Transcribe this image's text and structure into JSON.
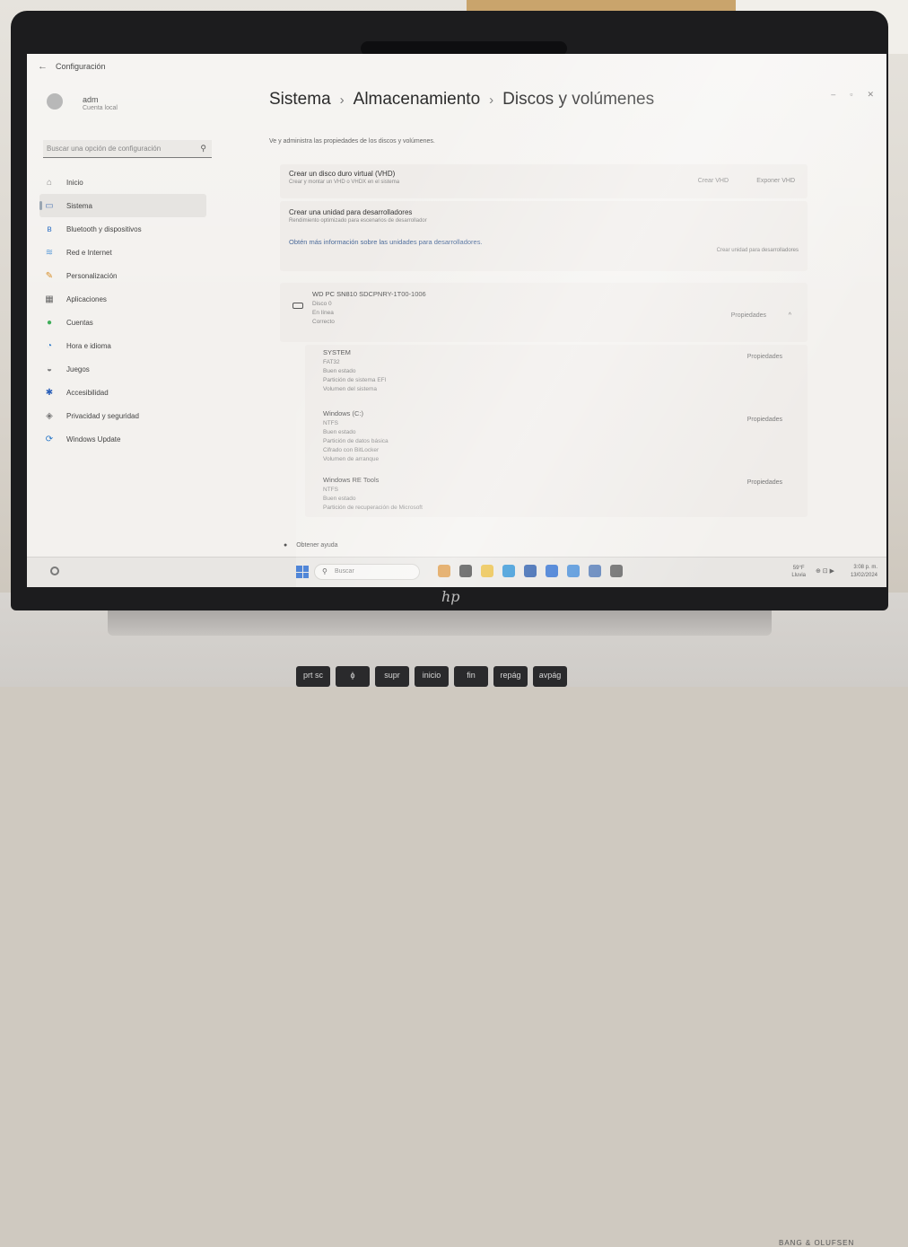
{
  "window": {
    "back": "←",
    "title": "Configuración",
    "controls": [
      "–",
      "▫",
      "✕"
    ]
  },
  "profile": {
    "name": "adm",
    "account": "Cuenta local"
  },
  "search": {
    "placeholder": "Buscar una opción de configuración",
    "icon": "search-icon"
  },
  "nav": [
    {
      "label": "Inicio",
      "icon": "home-icon"
    },
    {
      "label": "Sistema",
      "icon": "system-icon",
      "selected": true
    },
    {
      "label": "Bluetooth y dispositivos",
      "icon": "bluetooth-icon"
    },
    {
      "label": "Red e Internet",
      "icon": "wifi-icon"
    },
    {
      "label": "Personalización",
      "icon": "brush-icon"
    },
    {
      "label": "Aplicaciones",
      "icon": "apps-icon"
    },
    {
      "label": "Cuentas",
      "icon": "account-icon"
    },
    {
      "label": "Hora e idioma",
      "icon": "globe-icon"
    },
    {
      "label": "Juegos",
      "icon": "gamepad-icon"
    },
    {
      "label": "Accesibilidad",
      "icon": "accessibility-icon"
    },
    {
      "label": "Privacidad y seguridad",
      "icon": "shield-icon"
    },
    {
      "label": "Windows Update",
      "icon": "update-icon"
    }
  ],
  "breadcrumb": [
    "Sistema",
    "Almacenamiento",
    "Discos y volúmenes"
  ],
  "breadcrumb_sep": "›",
  "description": "Ve y administra las propiedades de los discos y volúmenes.",
  "vhd": {
    "title": "Crear un disco duro virtual (VHD)",
    "subtitle": "Crear y montar un VHD o VHDX en el sistema",
    "create": "Crear VHD",
    "attach": "Exponer VHD"
  },
  "devdrive": {
    "title": "Crear una unidad para desarrolladores",
    "subtitle": "Rendimiento optimizado para escenarios de desarrollador",
    "link": "Obtén más información sobre las unidades para desarrolladores.",
    "button": "Crear unidad para desarrolladores"
  },
  "disk": {
    "model": "WD PC SN810 SDCPNRY-1T00-1006",
    "lines": [
      "Disco 0",
      "En línea",
      "Correcto"
    ],
    "properties": "Propiedades",
    "chevron": "^"
  },
  "volumes": [
    {
      "name": "SYSTEM",
      "lines": [
        "FAT32",
        "Buen estado",
        "Partición de sistema EFI",
        "Volumen del sistema"
      ],
      "button": "Propiedades"
    },
    {
      "name": "Windows (C:)",
      "lines": [
        "NTFS",
        "Buen estado",
        "Partición de datos básica",
        "Cifrado con BitLocker",
        "Volumen de arranque"
      ],
      "button": "Propiedades"
    },
    {
      "name": "Windows RE Tools",
      "lines": [
        "NTFS",
        "Buen estado",
        "Partición de recuperación de Microsoft"
      ],
      "button": "Propiedades"
    }
  ],
  "help": "Obtener ayuda",
  "taskbar": {
    "search_placeholder": "Buscar",
    "weather_temp": "59°F",
    "weather_cond": "Lluvia",
    "tray_icons": "⊕ ⊡ ▶",
    "time": "3:08 p. m.",
    "date": "13/02/2024",
    "apps": [
      {
        "icon": "copilot-icon",
        "color": "#d98b2b"
      },
      {
        "icon": "taskview-icon",
        "color": "#333333"
      },
      {
        "icon": "explorer-icon",
        "color": "#e8b830"
      },
      {
        "icon": "edge-icon",
        "color": "#1f8ad2"
      },
      {
        "icon": "mail-icon",
        "color": "#2456a8"
      },
      {
        "icon": "store-icon",
        "color": "#2f6fd0"
      },
      {
        "icon": "app-icon",
        "color": "#4a8fd8"
      },
      {
        "icon": "people-icon",
        "color": "#5a7fb8"
      },
      {
        "icon": "settings-icon",
        "color": "#6a6a6a"
      }
    ]
  },
  "keyboard": {
    "keys": [
      "prt sc",
      "ϕ",
      "supr",
      "inicio",
      "fin",
      "repág",
      "avpág"
    ]
  },
  "brand": {
    "laptop_logo": "hp",
    "audio": "BANG & OLUFSEN"
  },
  "colors": {
    "accent": "#2f6fd0",
    "link": "#4a6a9a"
  }
}
